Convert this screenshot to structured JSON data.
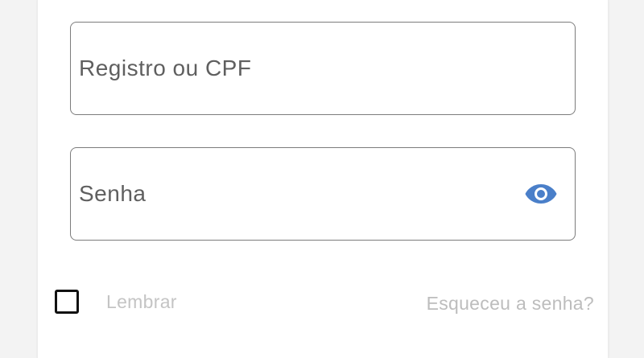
{
  "login_form": {
    "username": {
      "placeholder": "Registro ou CPF",
      "value": ""
    },
    "password": {
      "placeholder": "Senha",
      "value": "",
      "toggle_icon": "eye-icon"
    },
    "remember": {
      "label": "Lembrar",
      "checked": false
    },
    "forgot_link": "Esqueceu a senha?"
  },
  "colors": {
    "field_border": "#7c7c7c",
    "eye_icon": "#4a7fc9",
    "muted_text": "#c4c4c4"
  }
}
